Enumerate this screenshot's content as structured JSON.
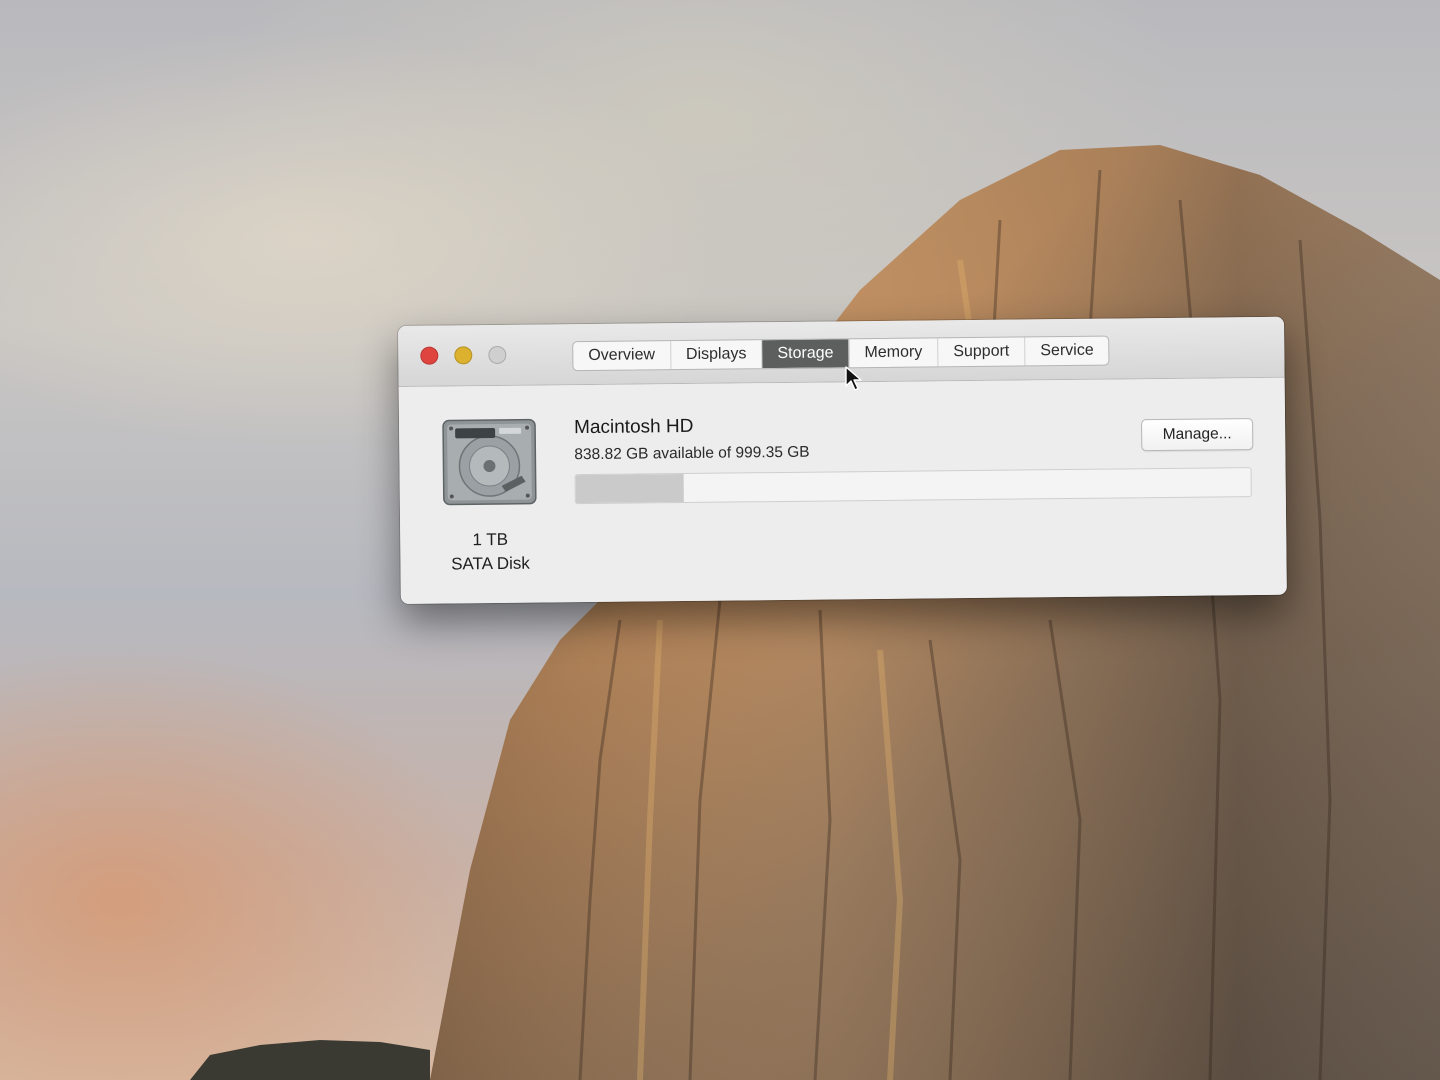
{
  "window": {
    "tabs": [
      {
        "label": "Overview",
        "active": false
      },
      {
        "label": "Displays",
        "active": false
      },
      {
        "label": "Storage",
        "active": true
      },
      {
        "label": "Memory",
        "active": false
      },
      {
        "label": "Support",
        "active": false
      },
      {
        "label": "Service",
        "active": false
      }
    ]
  },
  "storage": {
    "disk_size": "1 TB",
    "disk_type": "SATA Disk",
    "disk_icon": "hard-drive-icon",
    "volume_name": "Macintosh HD",
    "volume_info": "838.82 GB available of 999.35 GB",
    "used_fraction": 0.1607,
    "manage_label": "Manage..."
  },
  "colors": {
    "close": "#e0443e",
    "minimize": "#dcb12e",
    "zoom": "#cfcfcf",
    "active_tab": "#5d5f5f",
    "usage_fill": "#cacaca"
  }
}
